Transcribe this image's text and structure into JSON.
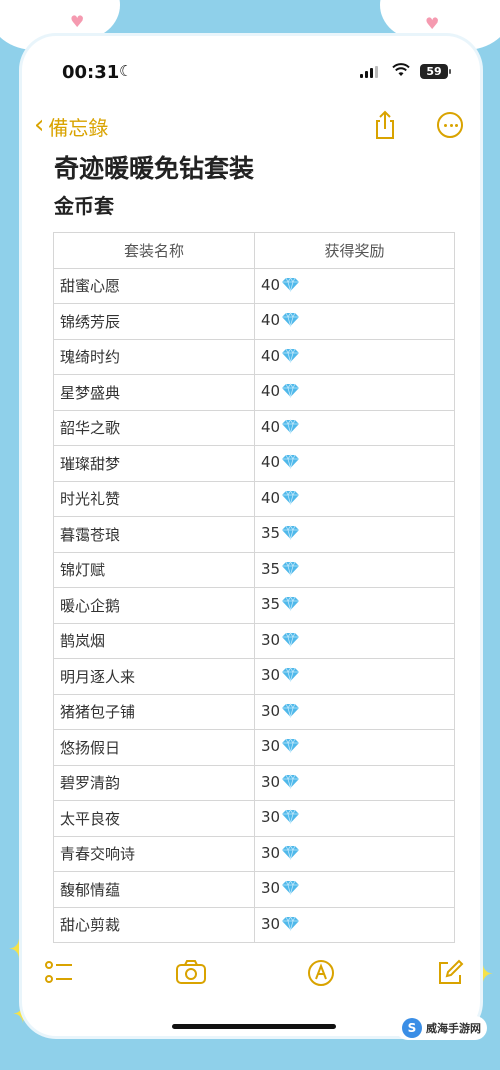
{
  "status_bar": {
    "time": "00:31",
    "battery": "59"
  },
  "nav": {
    "back_label": "備忘錄"
  },
  "note": {
    "title": "奇迹暖暖免钻套装",
    "subtitle": "金币套"
  },
  "table": {
    "headers": [
      "套装名称",
      "获得奖励"
    ],
    "rows": [
      {
        "name": "甜蜜心愿",
        "reward": "40"
      },
      {
        "name": "锦绣芳辰",
        "reward": "40"
      },
      {
        "name": "瑰绮时约",
        "reward": "40"
      },
      {
        "name": "星梦盛典",
        "reward": "40"
      },
      {
        "name": "韶华之歌",
        "reward": "40"
      },
      {
        "name": "璀璨甜梦",
        "reward": "40"
      },
      {
        "name": "时光礼赞",
        "reward": "40"
      },
      {
        "name": "暮霭苍琅",
        "reward": "35"
      },
      {
        "name": "锦灯赋",
        "reward": "35"
      },
      {
        "name": "暖心企鹅",
        "reward": "35"
      },
      {
        "name": "鹊岚烟",
        "reward": "30"
      },
      {
        "name": "明月逐人来",
        "reward": "30"
      },
      {
        "name": "猪猪包子铺",
        "reward": "30"
      },
      {
        "name": "悠扬假日",
        "reward": "30"
      },
      {
        "name": "碧罗清韵",
        "reward": "30"
      },
      {
        "name": "太平良夜",
        "reward": "30"
      },
      {
        "name": "青春交响诗",
        "reward": "30"
      },
      {
        "name": "馥郁情蕴",
        "reward": "30"
      },
      {
        "name": "甜心剪裁",
        "reward": "30"
      }
    ],
    "reward_icon": "diamond-icon"
  },
  "toolbar": {
    "icons": [
      "checklist-icon",
      "camera-icon",
      "markup-pen-icon",
      "compose-icon"
    ]
  },
  "watermark": {
    "text": "威海手游网"
  },
  "colors": {
    "accent": "#d9a300",
    "background": "#8fd0ea",
    "gem": "#4fb8ea"
  }
}
